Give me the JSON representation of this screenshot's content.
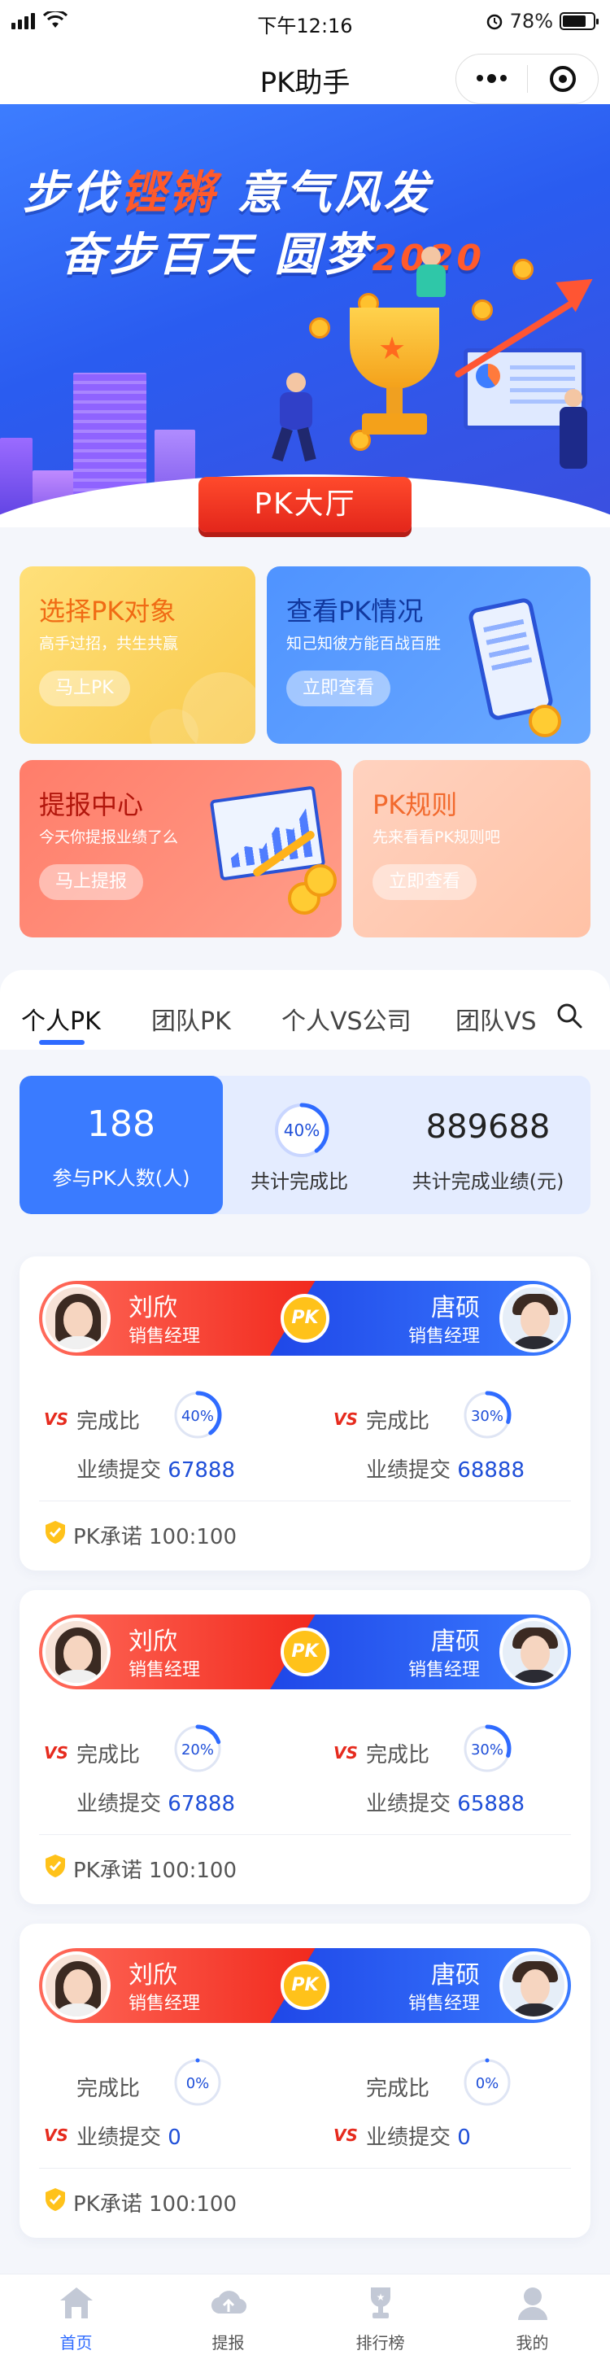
{
  "status_bar": {
    "time": "下午12:16",
    "battery": "78%",
    "battery_level": 0.78
  },
  "nav": {
    "title": "PK助手"
  },
  "banner": {
    "line1_a": "步伐",
    "line1_hl": "铿锵",
    "line1_b": " 意气风发",
    "line2_a": "奋步百天 圆梦",
    "line2_hl": "2020",
    "hall_button": "PK大厅"
  },
  "features": {
    "select": {
      "title": "选择PK对象",
      "subtitle": "高手过招，共生共赢",
      "button": "马上PK"
    },
    "view": {
      "title": "查看PK情况",
      "subtitle": "知己知彼方能百战百胜",
      "button": "立即查看"
    },
    "report": {
      "title": "提报中心",
      "subtitle": "今天你提报业绩了么",
      "button": "马上提报"
    },
    "rules": {
      "title": "PK规则",
      "subtitle": "先来看看PK规则吧",
      "button": "立即查看"
    }
  },
  "tabs": [
    "个人PK",
    "团队PK",
    "个人VS公司",
    "团队VS"
  ],
  "active_tab": 0,
  "stats": {
    "participants": "188",
    "participants_label": "参与PK人数(人)",
    "completion": "40%",
    "completion_value": 0.4,
    "completion_label": "共计完成比",
    "total": "889688",
    "total_label": "共计完成业绩(元)"
  },
  "pk_cards": [
    {
      "left": {
        "name": "刘欣",
        "role": "销售经理",
        "ratio_label": "完成比",
        "ratio": "40%",
        "ratio_value": 0.4,
        "submit_label": "业绩提交",
        "submit": "67888"
      },
      "right": {
        "name": "唐硕",
        "role": "销售经理",
        "ratio_label": "完成比",
        "ratio": "30%",
        "ratio_value": 0.3,
        "submit_label": "业绩提交",
        "submit": "68888"
      },
      "badge": "PK",
      "vs": "VS",
      "promise": "PK承诺 100:100"
    },
    {
      "left": {
        "name": "刘欣",
        "role": "销售经理",
        "ratio_label": "完成比",
        "ratio": "20%",
        "ratio_value": 0.2,
        "submit_label": "业绩提交",
        "submit": "67888"
      },
      "right": {
        "name": "唐硕",
        "role": "销售经理",
        "ratio_label": "完成比",
        "ratio": "30%",
        "ratio_value": 0.3,
        "submit_label": "业绩提交",
        "submit": "65888"
      },
      "badge": "PK",
      "vs": "VS",
      "promise": "PK承诺 100:100"
    },
    {
      "left": {
        "name": "刘欣",
        "role": "销售经理",
        "ratio_label": "完成比",
        "ratio": "0%",
        "ratio_value": 0,
        "submit_label": "业绩提交",
        "submit": "0"
      },
      "right": {
        "name": "唐硕",
        "role": "销售经理",
        "ratio_label": "完成比",
        "ratio": "0%",
        "ratio_value": 0,
        "submit_label": "业绩提交",
        "submit": "0"
      },
      "badge": "PK",
      "vs": "VS",
      "promise": "PK承诺 100:100"
    }
  ],
  "tabbar": [
    {
      "label": "首页",
      "icon": "home-icon",
      "active": true
    },
    {
      "label": "提报",
      "icon": "upload-icon",
      "active": false
    },
    {
      "label": "排行榜",
      "icon": "trophy-icon",
      "active": false
    },
    {
      "label": "我的",
      "icon": "user-icon",
      "active": false
    }
  ],
  "colors": {
    "primary": "#2f6bff",
    "red": "#f02418",
    "gold": "#ffc21a"
  }
}
